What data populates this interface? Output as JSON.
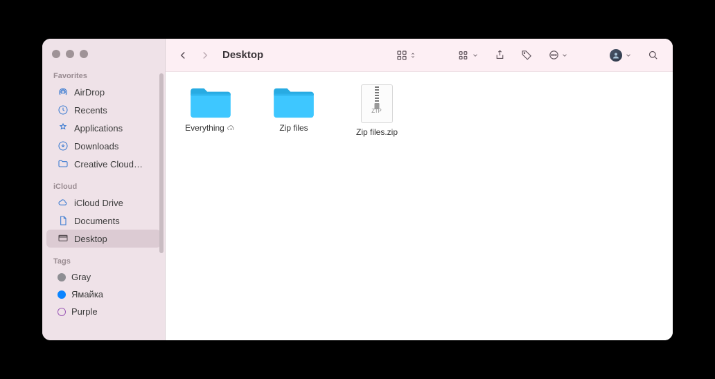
{
  "title": "Desktop",
  "traffic_buttons": [
    "close",
    "minimize",
    "zoom"
  ],
  "sidebar": {
    "sections": [
      {
        "label": "Favorites",
        "items": [
          {
            "icon": "airdrop",
            "label": "AirDrop"
          },
          {
            "icon": "clock",
            "label": "Recents"
          },
          {
            "icon": "apps",
            "label": "Applications"
          },
          {
            "icon": "download",
            "label": "Downloads"
          },
          {
            "icon": "folder",
            "label": "Creative Cloud…"
          }
        ]
      },
      {
        "label": "iCloud",
        "items": [
          {
            "icon": "cloud",
            "label": "iCloud Drive"
          },
          {
            "icon": "doc",
            "label": "Documents"
          },
          {
            "icon": "desktop",
            "label": "Desktop",
            "selected": true
          }
        ]
      },
      {
        "label": "Tags",
        "items": [
          {
            "icon": "tag",
            "label": "Gray",
            "color": "#8e8e93"
          },
          {
            "icon": "tag",
            "label": "Ямайка",
            "color": "#0a84ff"
          },
          {
            "icon": "tag",
            "label": "Purple",
            "color": "#9b59b6"
          }
        ]
      }
    ]
  },
  "toolbar": {
    "view_mode": "icon-grid",
    "group_mode": "group",
    "actions": [
      "share",
      "tag",
      "more"
    ],
    "avatar_menu": true,
    "search": true
  },
  "items": [
    {
      "type": "folder",
      "name": "Everything",
      "cloud": true
    },
    {
      "type": "folder",
      "name": "Zip files"
    },
    {
      "type": "zip",
      "name": "Zip files.zip",
      "badge": "ZIP"
    }
  ]
}
